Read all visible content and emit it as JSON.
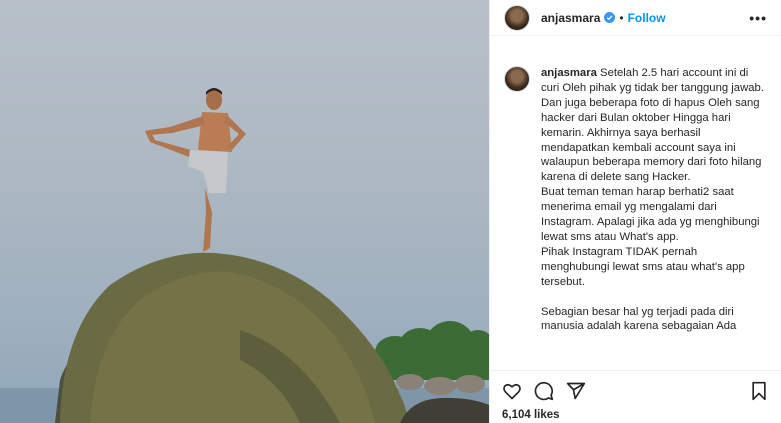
{
  "post": {
    "username": "anjasmara",
    "separator": "•",
    "follow_label": "Follow",
    "more_label": "•••",
    "caption_username": "anjasmara",
    "caption_text": "Setelah 2.5 hari account ini di curi Oleh pihak yg tidak ber tanggung jawab. Dan juga beberapa foto di hapus Oleh sang hacker dari Bulan oktober Hingga hari kemarin. Akhirnya saya berhasil mendapatkan kembali account saya ini walaupun beberapa memory dari foto hilang karena di delete sang Hacker.\nBuat teman teman harap berhati2 saat menerima email yg mengalami dari Instagram. Apalagi jika ada yg menghibungi lewat sms atau What's app.\nPihak Instagram TIDAK pernah menghubungi lewat sms atau what's app tersebut.\n\nSebagian besar hal yg terjadi pada diri manusia adalah karena sebagaian Ada",
    "likes": "6,104 likes",
    "accent": "#0095f6",
    "verified_color": "#3897f0"
  },
  "icons": {
    "like": "heart-icon",
    "comment": "comment-icon",
    "share": "share-icon",
    "save": "bookmark-icon"
  }
}
